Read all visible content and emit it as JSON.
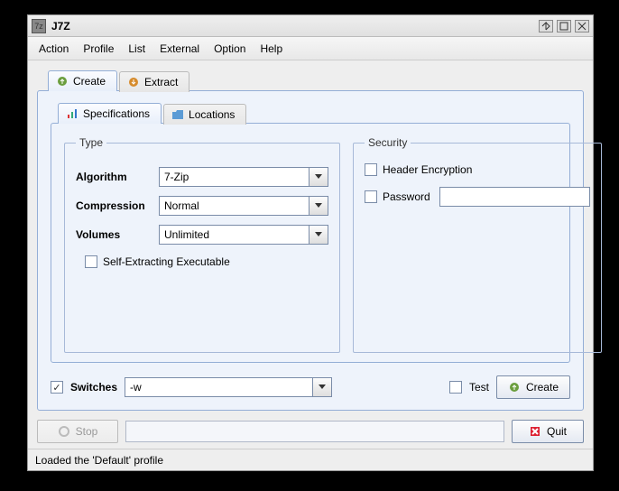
{
  "window": {
    "title": "J7Z"
  },
  "menu": {
    "items": [
      "Action",
      "Profile",
      "List",
      "External",
      "Option",
      "Help"
    ]
  },
  "outerTabs": {
    "create": "Create",
    "extract": "Extract"
  },
  "innerTabs": {
    "specifications": "Specifications",
    "locations": "Locations"
  },
  "type": {
    "legend": "Type",
    "algorithmLabel": "Algorithm",
    "algorithmValue": "7-Zip",
    "compressionLabel": "Compression",
    "compressionValue": "Normal",
    "volumesLabel": "Volumes",
    "volumesValue": "Unlimited",
    "selfExtracting": "Self-Extracting Executable"
  },
  "security": {
    "legend": "Security",
    "headerEncryption": "Header Encryption",
    "passwordLabel": "Password",
    "passwordValue": ""
  },
  "switches": {
    "label": "Switches",
    "checked": true,
    "value": "-w"
  },
  "buttons": {
    "test": "Test",
    "create": "Create",
    "stop": "Stop",
    "quit": "Quit"
  },
  "statusText": "Loaded the 'Default' profile"
}
